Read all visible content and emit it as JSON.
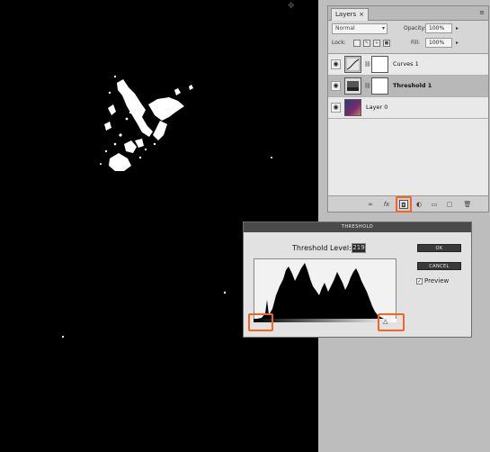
{
  "layers_panel": {
    "tab_label": "Layers",
    "tab_close": "×",
    "menu_icon": "≡",
    "blend_mode": "Normal",
    "opacity_label": "Opacity:",
    "opacity_value": "100%",
    "lock_label": "Lock:",
    "fill_label": "Fill:",
    "fill_value": "100%",
    "layers": [
      {
        "name": "Curves 1",
        "selected": false,
        "type": "adjustment-curves"
      },
      {
        "name": "Threshold 1",
        "selected": true,
        "type": "adjustment-threshold"
      },
      {
        "name": "Layer 0",
        "selected": false,
        "type": "image"
      }
    ],
    "bottom_icons": [
      "link-icon",
      "fx-icon",
      "mask-icon",
      "adjustment-icon",
      "group-icon",
      "new-layer-icon",
      "trash-icon"
    ],
    "highlighted_icon": "mask-icon"
  },
  "threshold_dialog": {
    "title": "THRESHOLD",
    "level_label": "Threshold Level:",
    "level_value": "219",
    "ok_label": "OK",
    "cancel_label": "CANCEL",
    "preview_label": "Preview",
    "preview_checked": true,
    "accent_color": "#f26522"
  }
}
